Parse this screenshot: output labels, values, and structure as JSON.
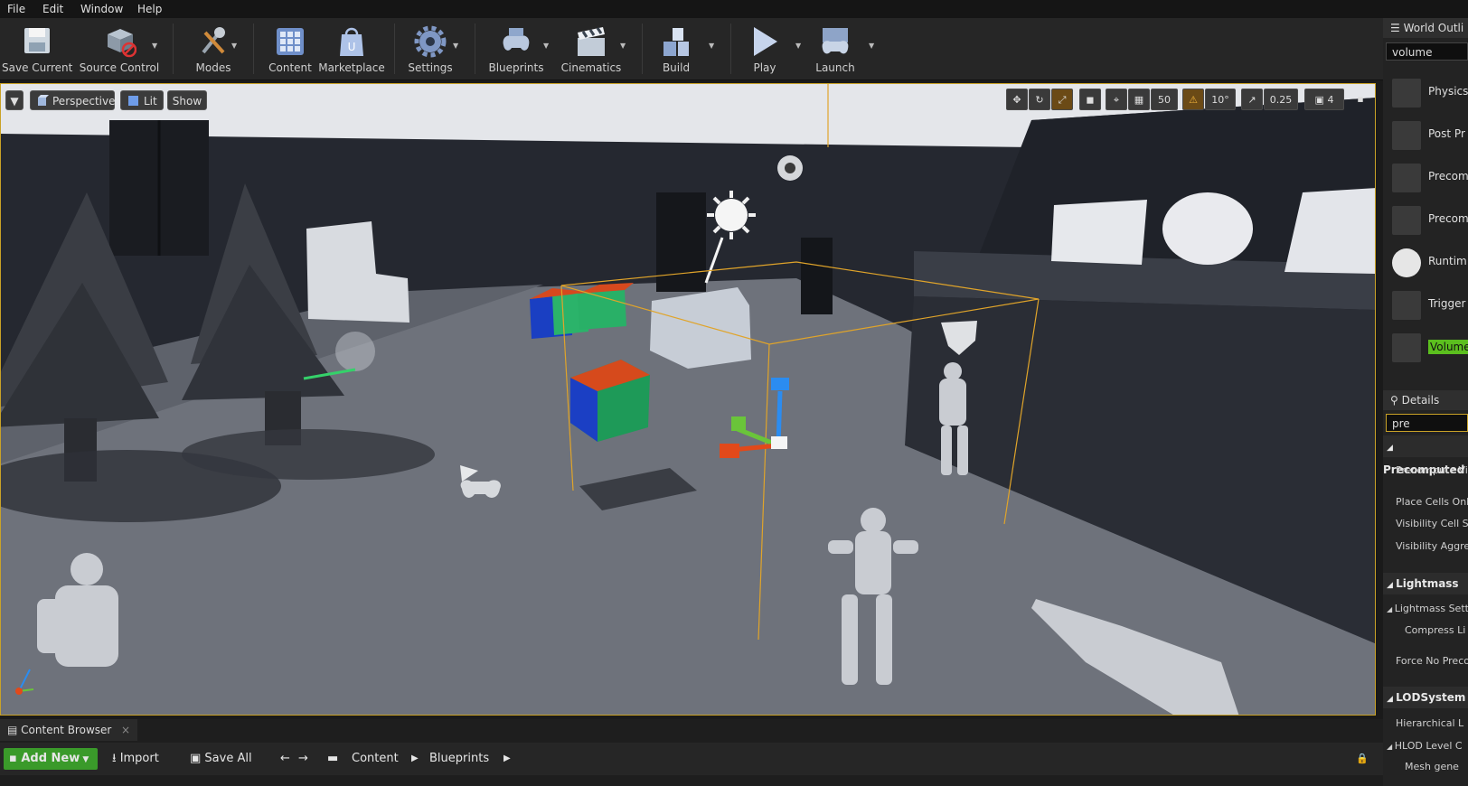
{
  "menu": [
    "File",
    "Edit",
    "Window",
    "Help"
  ],
  "toolbar": {
    "save_current": "Save Current",
    "source_control": "Source Control",
    "modes": "Modes",
    "content": "Content",
    "marketplace": "Marketplace",
    "settings": "Settings",
    "blueprints": "Blueprints",
    "cinematics": "Cinematics",
    "build": "Build",
    "play": "Play",
    "launch": "Launch"
  },
  "viewport": {
    "perspective": "Perspective",
    "lit": "Lit",
    "show": "Show",
    "grid_snap": "50",
    "rotation_snap": "10°",
    "scale_snap": "0.25",
    "camera_speed": "4"
  },
  "world_outliner": {
    "title": "World Outli",
    "search": "volume",
    "items": [
      "Physics",
      "Post Pr",
      "Precom",
      "Precom",
      "Runtim",
      "Trigger",
      "Volume"
    ]
  },
  "details": {
    "title": "Details",
    "search": "pre",
    "sections": {
      "precomputed": "Precomputed",
      "precompute_vis": "Precompute Vi",
      "place_cells": "Place Cells Onl",
      "visibility_cell": "Visibility Cell S",
      "visibility_aggr": "Visibility Aggre",
      "lightmass": "Lightmass",
      "lightmass_settings": "Lightmass Setti",
      "compress": "Compress Li",
      "force_no_precomp": "Force No Preco",
      "lod_system": "LODSystem",
      "hierarchical": "Hierarchical L",
      "hlod_level": "HLOD Level C",
      "mesh_gen": "Mesh gene"
    }
  },
  "content_browser": {
    "tab": "Content Browser",
    "add_new": "Add New",
    "import": "Import",
    "save_all": "Save All",
    "path": [
      "Content",
      "Blueprints"
    ]
  },
  "colors": {
    "accent_orange": "#c9a227",
    "add_new_green": "#3a9a2a",
    "volume_highlight": "#5bbf1e"
  }
}
